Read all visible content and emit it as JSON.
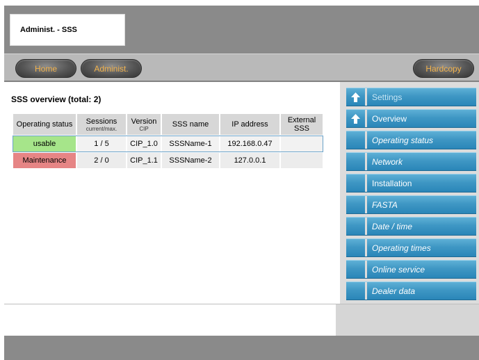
{
  "header": {
    "title": "Administ. - SSS"
  },
  "nav": {
    "home": "Home",
    "admin": "Administ.",
    "hardcopy": "Hardcopy"
  },
  "overview": {
    "title": "SSS overview (total: 2)",
    "columns": [
      {
        "label": "Operating status",
        "sub": ""
      },
      {
        "label": "Sessions",
        "sub": "current/max."
      },
      {
        "label": "Version",
        "sub": "CIP"
      },
      {
        "label": "SSS name",
        "sub": ""
      },
      {
        "label": "IP address",
        "sub": ""
      },
      {
        "label": "External SSS",
        "sub": ""
      }
    ],
    "rows": [
      {
        "status": "usable",
        "sessions": "1 / 5",
        "version": "CIP_1.0",
        "name": "SSSName-1",
        "ip": "192.168.0.47",
        "external": ""
      },
      {
        "status": "Maintenance",
        "sessions": "2 / 0",
        "version": "CIP_1.1",
        "name": "SSSName-2",
        "ip": "127.0.0.1",
        "external": ""
      }
    ]
  },
  "menu": {
    "items": [
      {
        "label": "Settings",
        "arrow": true
      },
      {
        "label": "Overview",
        "arrow": true
      },
      {
        "label": "Operating status",
        "arrow": false
      },
      {
        "label": "Network",
        "arrow": false
      },
      {
        "label": "Installation",
        "arrow": false
      },
      {
        "label": "FASTA",
        "arrow": false
      },
      {
        "label": "Date / time",
        "arrow": false
      },
      {
        "label": "Operating times",
        "arrow": false
      },
      {
        "label": "Online service",
        "arrow": false
      },
      {
        "label": "Dealer data",
        "arrow": false
      }
    ]
  },
  "colors": {
    "usable": "#a6e58a",
    "maintenance": "#e68585",
    "menu_blue": "#3f97c4",
    "button_text": "#f2b34d"
  }
}
